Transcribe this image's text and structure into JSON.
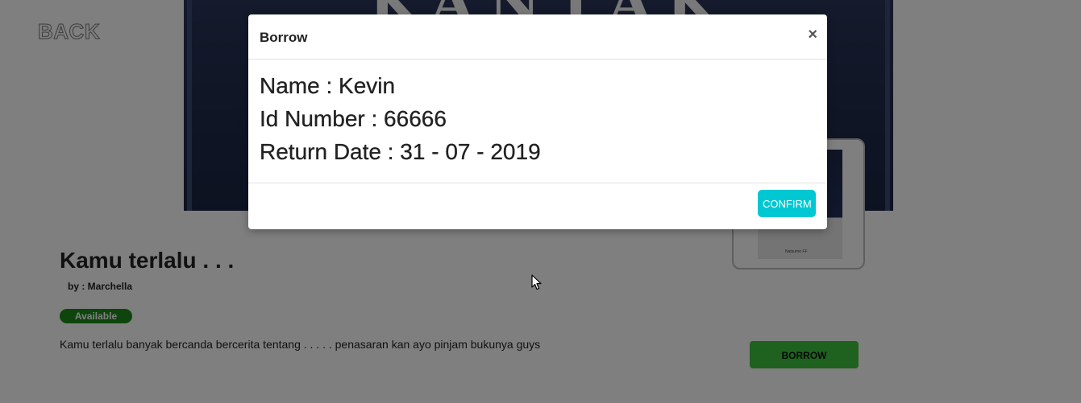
{
  "header": {
    "back_label": "BACK"
  },
  "cover": {
    "letters": "KANTAK"
  },
  "book": {
    "title": "Kamu terlalu . . .",
    "author": "by : Marchella",
    "status": "Available",
    "description": "Kamu terlalu banyak bercanda bercerita tentang . . . . . penasaran kan ayo pinjam bukunya guys",
    "borrow_label": "BORROW",
    "thumb_caption": "Natsume FF"
  },
  "modal": {
    "title": "Borrow",
    "close_glyph": "×",
    "lines": [
      "Name : Kevin",
      "Id Number : 66666",
      "Return Date : 31 - 07 - 2019"
    ],
    "confirm_label": "CONFIRM"
  },
  "colors": {
    "confirm": "#00c8d2",
    "borrow": "#3fc33f",
    "status_badge": "#1a8a1a",
    "cover": "#1f2a4a"
  },
  "icons": {
    "cursor": "mouse-pointer-icon",
    "close": "close-icon"
  }
}
